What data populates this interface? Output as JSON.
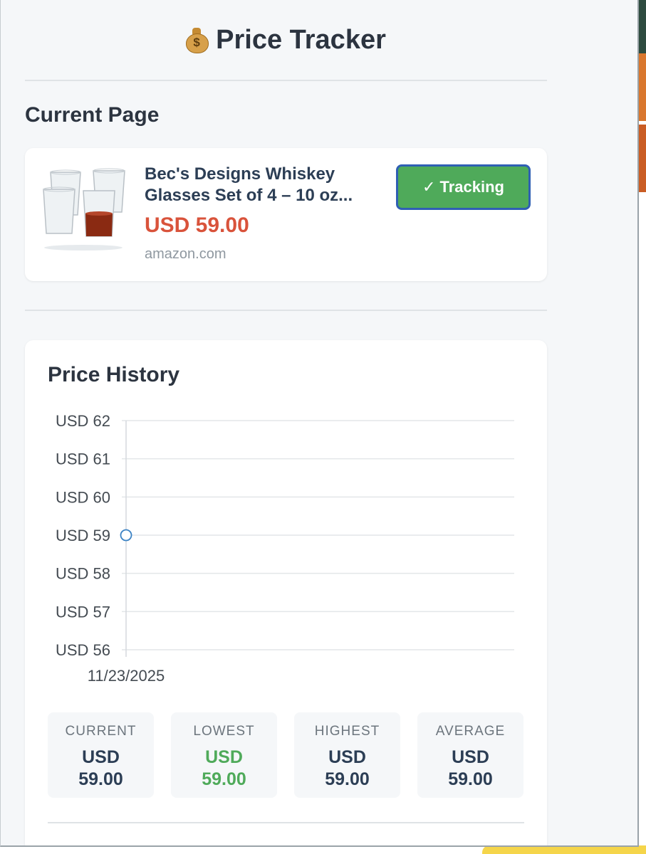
{
  "header": {
    "title": "Price Tracker",
    "icon": "money-bag-icon"
  },
  "current_page": {
    "section_title": "Current Page",
    "product": {
      "name": "Bec's Designs Whiskey Glasses Set of 4 – 10 oz...",
      "price": "USD 59.00",
      "domain": "amazon.com",
      "image": "whiskey-glasses-thumbnail",
      "tracking_button": {
        "check": "✓",
        "label": "Tracking"
      }
    }
  },
  "history": {
    "section_title": "Price History",
    "stats": [
      {
        "label": "CURRENT",
        "value": "USD 59.00",
        "color": "#2c3e55"
      },
      {
        "label": "LOWEST",
        "value": "USD 59.00",
        "color": "#4faa5a"
      },
      {
        "label": "HIGHEST",
        "value": "USD 59.00",
        "color": "#2c3e55"
      },
      {
        "label": "AVERAGE",
        "value": "USD 59.00",
        "color": "#2c3e55"
      }
    ]
  },
  "colors": {
    "accent_green": "#4faa5a",
    "price_red": "#d9533b",
    "point_blue": "#3b82c4"
  },
  "chart_data": {
    "type": "line",
    "x": [
      "11/23/2025"
    ],
    "series": [
      {
        "values": [
          59
        ]
      }
    ],
    "ylim": [
      56,
      62
    ],
    "y_ticks": [
      "USD 62",
      "USD 61",
      "USD 60",
      "USD 59",
      "USD 58",
      "USD 57",
      "USD 56"
    ],
    "y_tick_values": [
      62,
      61,
      60,
      59,
      58,
      57,
      56
    ],
    "grid": true
  }
}
